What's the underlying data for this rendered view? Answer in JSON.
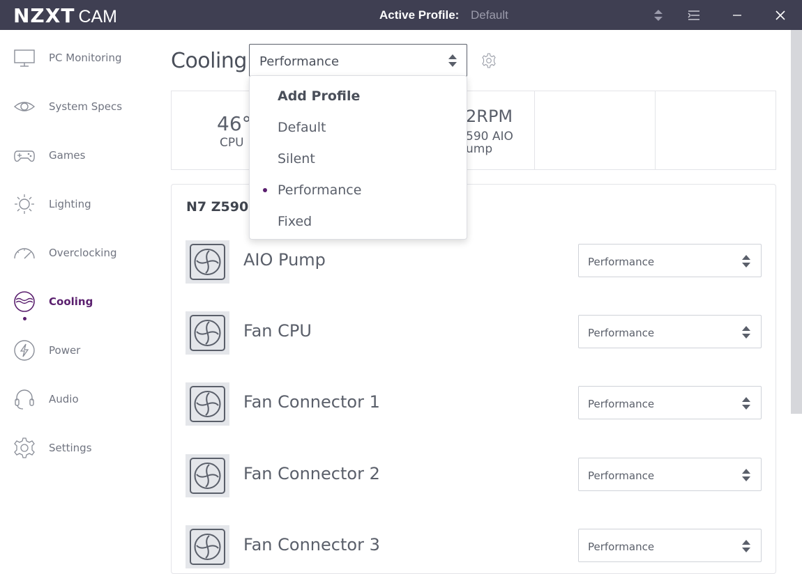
{
  "titlebar": {
    "logo_main": "NZXT",
    "logo_sub": "CAM",
    "active_profile_label": "Active Profile:",
    "active_profile_value": "Default"
  },
  "sidebar": {
    "items": [
      {
        "label": "PC Monitoring",
        "icon": "monitor-icon"
      },
      {
        "label": "System Specs",
        "icon": "eye-icon"
      },
      {
        "label": "Games",
        "icon": "gamepad-icon"
      },
      {
        "label": "Lighting",
        "icon": "sun-icon"
      },
      {
        "label": "Overclocking",
        "icon": "gauge-icon"
      },
      {
        "label": "Cooling",
        "icon": "cooling-icon",
        "active": true
      },
      {
        "label": "Power",
        "icon": "power-icon"
      },
      {
        "label": "Audio",
        "icon": "headset-icon"
      },
      {
        "label": "Settings",
        "icon": "gear-icon"
      }
    ]
  },
  "main": {
    "title": "Cooling",
    "profile_select": "Performance",
    "stats": [
      {
        "value": "46°",
        "label": "CPU"
      },
      {
        "value": "2RPM",
        "label": "590 AIO",
        "label2": "ump"
      }
    ],
    "device_title": "N7 Z590",
    "devices": [
      {
        "name": "AIO Pump",
        "profile": "Performance"
      },
      {
        "name": "Fan CPU",
        "profile": "Performance"
      },
      {
        "name": "Fan Connector 1",
        "profile": "Performance"
      },
      {
        "name": "Fan Connector 2",
        "profile": "Performance"
      },
      {
        "name": "Fan Connector 3",
        "profile": "Performance"
      }
    ]
  },
  "dropdown": {
    "items": [
      "Add Profile",
      "Default",
      "Silent",
      "Performance",
      "Fixed"
    ],
    "selected": "Performance"
  },
  "colors": {
    "titlebar_bg": "#3f3f52",
    "accent": "#5a1f6e",
    "text": "#5a5f6a"
  }
}
